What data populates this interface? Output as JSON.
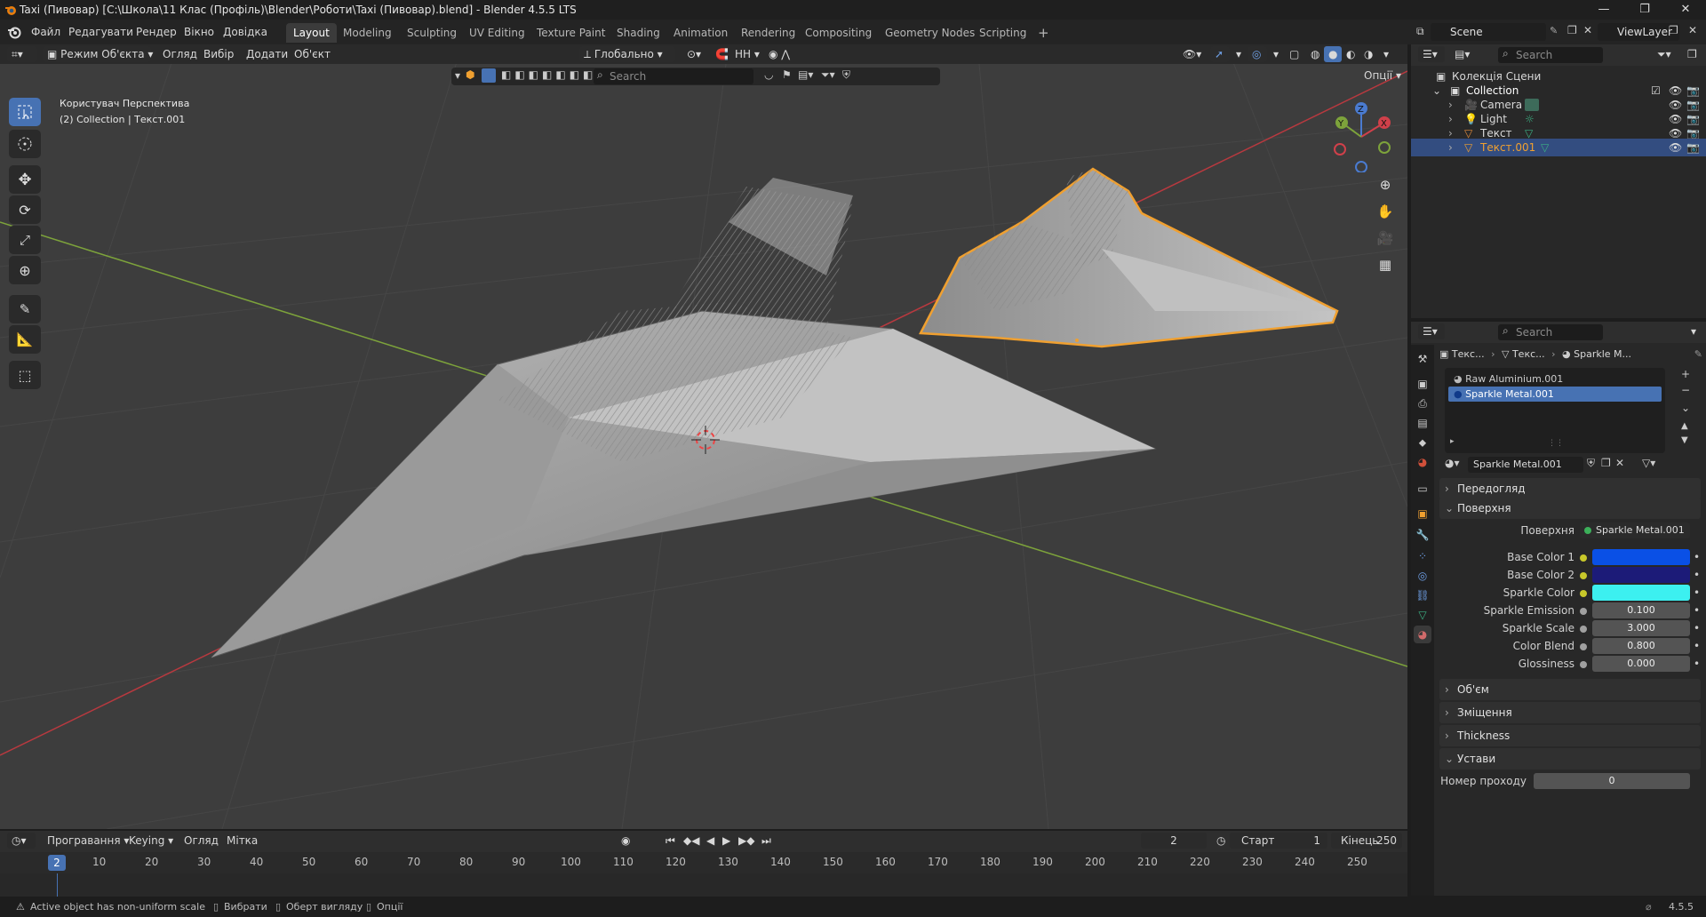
{
  "window": {
    "title": "Taxi (Пивовар) [C:\\Школа\\11 Клас (Профіль)\\Blender\\Роботи\\Taxi (Пивовар).blend] - Blender 4.5.5 LTS",
    "minimize": "—",
    "maximize": "❐",
    "close": "✕"
  },
  "menu": {
    "items": [
      "Файл",
      "Редагувати",
      "Рендер",
      "Вікно",
      "Довідка"
    ],
    "workspaces": [
      "Layout",
      "Modeling",
      "Sculpting",
      "UV Editing",
      "Texture Paint",
      "Shading",
      "Animation",
      "Rendering",
      "Compositing",
      "Geometry Nodes",
      "Scripting"
    ],
    "active_workspace": "Layout",
    "add_workspace": "+",
    "scene": "Scene",
    "view_layer": "ViewLayer"
  },
  "viewport": {
    "mode": "Режим Об'єкта",
    "menus": [
      "Огляд",
      "Вибір",
      "Додати",
      "Об'єкт"
    ],
    "transform_orientation": "Глобально",
    "snap": "НН",
    "options": "Опції",
    "search_placeholder": "Search",
    "overlay_line1": "Користувач Перспектива",
    "overlay_line2": "(2) Collection | Текст.001",
    "gizmo": {
      "x": "X",
      "y": "Y",
      "z": "Z"
    }
  },
  "timeline": {
    "menus": [
      "Програвання",
      "Keying",
      "Огляд",
      "Мітка"
    ],
    "current_frame": "2",
    "start_label": "Старт",
    "start": "1",
    "end_label": "Кінець",
    "end": "250",
    "ruler": [
      "10",
      "20",
      "30",
      "40",
      "50",
      "60",
      "70",
      "80",
      "90",
      "100",
      "110",
      "120",
      "130",
      "140",
      "150",
      "160",
      "170",
      "180",
      "190",
      "200",
      "210",
      "220",
      "230",
      "240",
      "250"
    ],
    "playhead": "2"
  },
  "status": {
    "warning": "Active object has non-uniform scale",
    "hint1": "Вибрати",
    "hint2": "Оберт вигляду",
    "hint3": "Опції",
    "version": "4.5.5"
  },
  "outliner": {
    "search_placeholder": "Search",
    "root": "Колекція Сцени",
    "collection": "Collection",
    "items": [
      {
        "name": "Camera",
        "icon": "camera-icon",
        "selected": false
      },
      {
        "name": "Light",
        "icon": "light-icon",
        "selected": false
      },
      {
        "name": "Текст",
        "icon": "mesh-icon",
        "selected": false
      },
      {
        "name": "Текст.001",
        "icon": "mesh-icon",
        "selected": true
      }
    ]
  },
  "properties": {
    "search_placeholder": "Search",
    "breadcrumb": [
      "Текс...",
      "Текс...",
      "Sparkle M..."
    ],
    "material_slots": [
      "Raw Aluminium.001",
      "Sparkle Metal.001"
    ],
    "active_slot": "Sparkle Metal.001",
    "material_name": "Sparkle Metal.001",
    "panels": {
      "preview": "Передогляд",
      "surface": "Поверхня",
      "volume": "Об'єм",
      "displacement": "Зміщення",
      "thickness": "Thickness",
      "settings": "Устави"
    },
    "surface_label": "Поверхня",
    "surface_value": "Sparkle Metal.001",
    "inputs": [
      {
        "label": "Base Color 1",
        "type": "color",
        "color": "#0a50e6"
      },
      {
        "label": "Base Color 2",
        "type": "color",
        "color": "#1c1b78"
      },
      {
        "label": "Sparkle Color",
        "type": "color",
        "color": "#3cf0f0"
      },
      {
        "label": "Sparkle Emission",
        "type": "value",
        "value": "0.100"
      },
      {
        "label": "Sparkle Scale",
        "type": "value",
        "value": "3.000"
      },
      {
        "label": "Color Blend",
        "type": "value",
        "value": "0.800"
      },
      {
        "label": "Glossiness",
        "type": "value",
        "value": "0.000"
      }
    ],
    "pass_index_label": "Номер проходу",
    "pass_index": "0"
  },
  "colors": {
    "accent": "#4772b3",
    "selection_outline": "#f0a030",
    "viewport_bg": "#3d3d3d"
  }
}
